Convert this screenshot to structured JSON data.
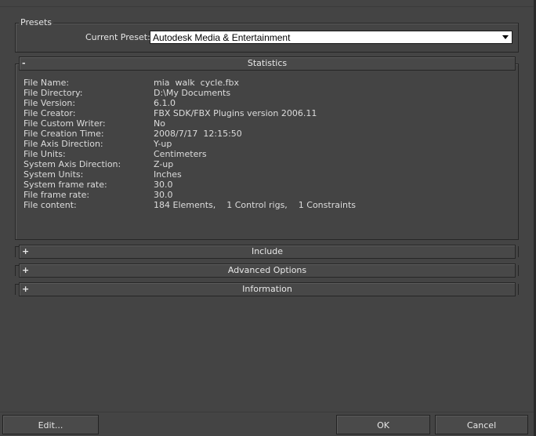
{
  "presets": {
    "legend": "Presets",
    "current_label": "Current Preset:",
    "current_value": "Autodesk Media & Entertainment"
  },
  "rollouts": {
    "statistics": {
      "sign": "-",
      "label": "Statistics"
    },
    "include": {
      "sign": "+",
      "label": "Include"
    },
    "advanced": {
      "sign": "+",
      "label": "Advanced Options"
    },
    "information": {
      "sign": "+",
      "label": "Information"
    }
  },
  "statistics": [
    {
      "key": "File Name:",
      "value": "mia  walk  cycle.fbx"
    },
    {
      "key": "File Directory:",
      "value": "D:\\My Documents"
    },
    {
      "key": "File Version:",
      "value": "6.1.0"
    },
    {
      "key": "File Creator:",
      "value": "FBX SDK/FBX Plugins version 2006.11"
    },
    {
      "key": "File Custom Writer:",
      "value": "No"
    },
    {
      "key": "File Creation Time:",
      "value": "2008/7/17  12:15:50"
    },
    {
      "key": "File Axis Direction:",
      "value": "Y-up"
    },
    {
      "key": "File Units:",
      "value": "Centimeters"
    },
    {
      "key": "System Axis Direction:",
      "value": "Z-up"
    },
    {
      "key": "System Units:",
      "value": "Inches"
    },
    {
      "key": "System frame rate:",
      "value": "30.0"
    },
    {
      "key": "File frame rate:",
      "value": "30.0"
    },
    {
      "key": "File content:",
      "value": "184 Elements,    1 Control rigs,    1 Constraints"
    }
  ],
  "buttons": {
    "edit": "Edit...",
    "ok": "OK",
    "cancel": "Cancel"
  }
}
